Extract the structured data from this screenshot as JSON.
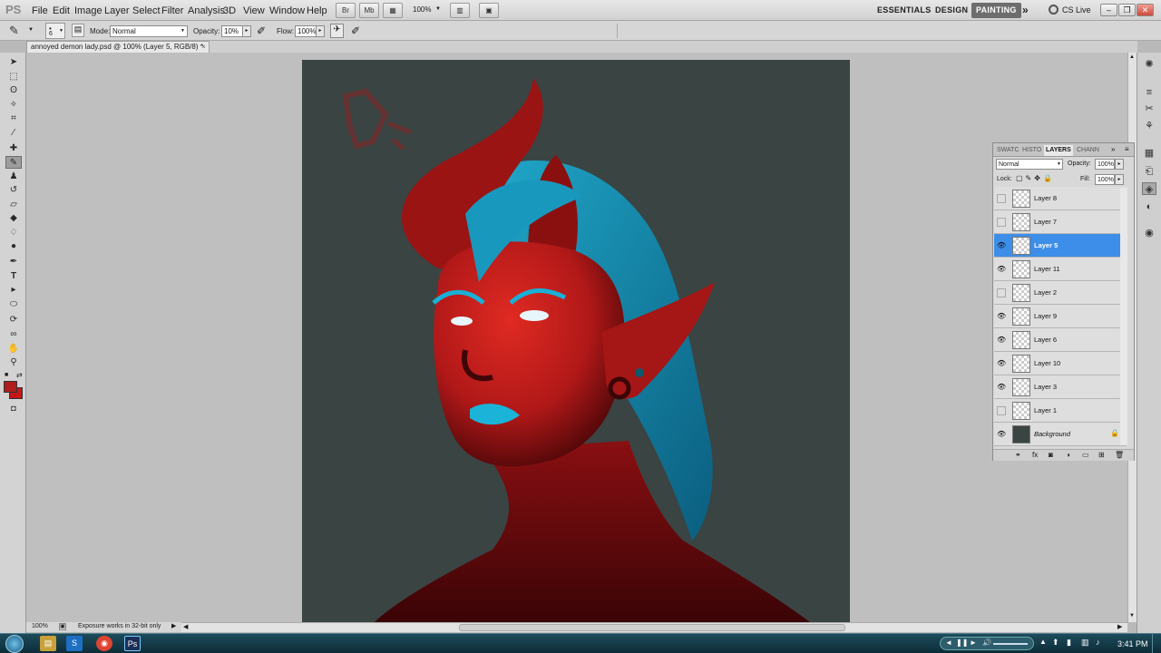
{
  "app": {
    "logo": "PS",
    "menus": [
      "File",
      "Edit",
      "Image",
      "Layer",
      "Select",
      "Filter",
      "Analysis",
      "3D",
      "View",
      "Window",
      "Help"
    ],
    "zoom_dropdown": "100%",
    "workspaces": [
      "ESSENTIALS",
      "DESIGN",
      "PAINTING"
    ],
    "active_workspace": "PAINTING",
    "more_workspaces": "»",
    "cs_live": "CS Live"
  },
  "options": {
    "brush_size": "6",
    "mode_label": "Mode:",
    "mode_value": "Normal",
    "opacity_label": "Opacity:",
    "opacity_value": "10%",
    "flow_label": "Flow:",
    "flow_value": "100%"
  },
  "document": {
    "tab_title": "annoyed demon lady.psd @ 100% (Layer 5, RGB/8) *",
    "tab_close": "×"
  },
  "status": {
    "zoom": "100%",
    "message": "Exposure works in 32-bit only"
  },
  "layers_panel": {
    "tabs": [
      "SWATC",
      "HISTO",
      "LAYERS",
      "CHANN"
    ],
    "active_tab": "LAYERS",
    "blend_mode": "Normal",
    "opacity_label": "Opacity:",
    "opacity_value": "100%",
    "lock_label": "Lock:",
    "fill_label": "Fill:",
    "fill_value": "100%",
    "layers": [
      {
        "name": "Layer 8",
        "visible": false,
        "selected": false
      },
      {
        "name": "Layer 7",
        "visible": false,
        "selected": false
      },
      {
        "name": "Layer 5",
        "visible": true,
        "selected": true
      },
      {
        "name": "Layer 11",
        "visible": true,
        "selected": false
      },
      {
        "name": "Layer 2",
        "visible": false,
        "selected": false
      },
      {
        "name": "Layer 9",
        "visible": true,
        "selected": false
      },
      {
        "name": "Layer 6",
        "visible": true,
        "selected": false
      },
      {
        "name": "Layer 10",
        "visible": true,
        "selected": false
      },
      {
        "name": "Layer 3",
        "visible": true,
        "selected": false
      },
      {
        "name": "Layer 1",
        "visible": false,
        "selected": false
      },
      {
        "name": "Background",
        "visible": true,
        "selected": false
      }
    ]
  },
  "colors": {
    "foreground": "#b01c1c",
    "background": "#c41616",
    "selected_layer": "#3d8ee8",
    "canvas_bg": "#3a4443"
  },
  "taskbar": {
    "clock": "3:41 PM"
  }
}
